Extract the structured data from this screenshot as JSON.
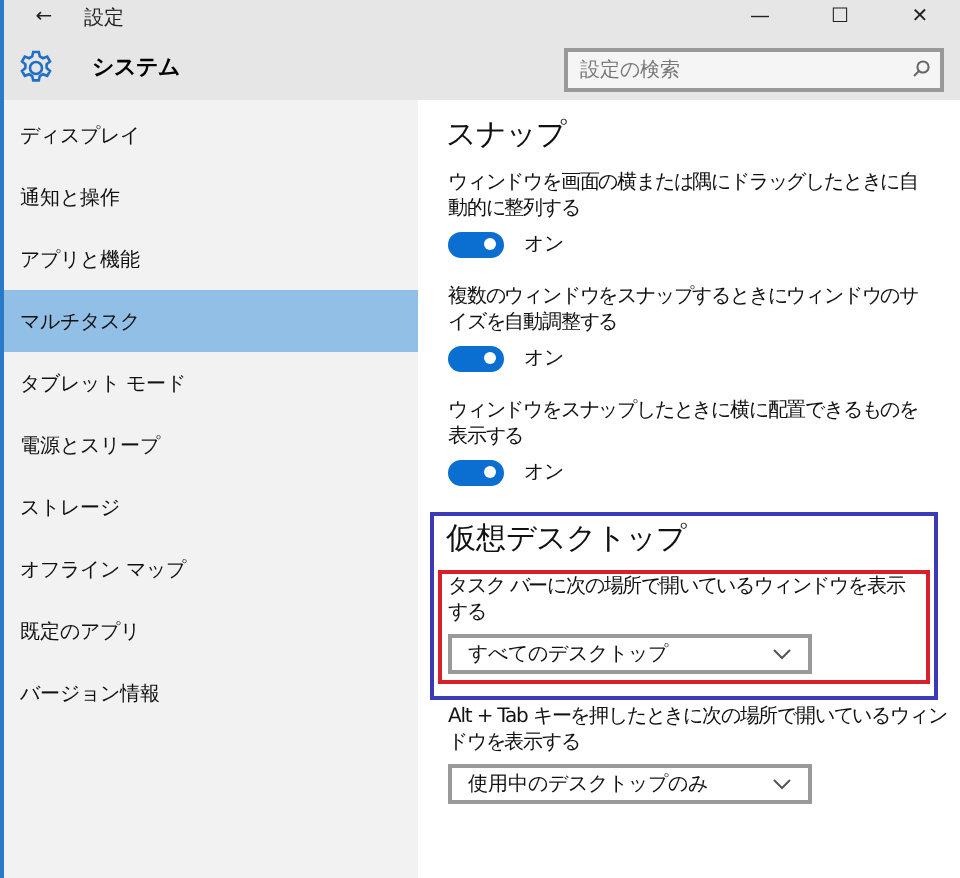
{
  "window": {
    "back": "←",
    "title": "設定",
    "controls": [
      "—",
      "☐",
      "✕"
    ]
  },
  "header": {
    "title": "システム",
    "search": {
      "placeholder": "設定の検索"
    }
  },
  "sidebar": {
    "items": [
      {
        "label": "ディスプレイ",
        "selected": false
      },
      {
        "label": "通知と操作",
        "selected": false
      },
      {
        "label": "アプリと機能",
        "selected": false
      },
      {
        "label": "マルチタスク",
        "selected": true
      },
      {
        "label": "タブレット モード",
        "selected": false
      },
      {
        "label": "電源とスリープ",
        "selected": false
      },
      {
        "label": "ストレージ",
        "selected": false
      },
      {
        "label": "オフライン マップ",
        "selected": false
      },
      {
        "label": "既定のアプリ",
        "selected": false
      },
      {
        "label": "バージョン情報",
        "selected": false
      }
    ]
  },
  "sections": [
    {
      "title": "スナップ",
      "outlined": false,
      "settings": [
        {
          "kind": "toggle",
          "label": "ウィンドウを画面の横または隅にドラッグしたときに自動的に整列する",
          "on": true,
          "state_text": "オン",
          "outlined": false
        },
        {
          "kind": "toggle",
          "label": "複数のウィンドウをスナップするときにウィンドウのサイズを自動調整する",
          "on": true,
          "state_text": "オン",
          "outlined": false
        },
        {
          "kind": "toggle",
          "label": "ウィンドウをスナップしたときに横に配置できるものを表示する",
          "on": true,
          "state_text": "オン",
          "outlined": false
        }
      ]
    },
    {
      "title": "仮想デスクトップ",
      "outlined": true,
      "settings": [
        {
          "kind": "dropdown",
          "label": "タスク バーに次の場所で開いているウィンドウを表示する",
          "value": "すべてのデスクトップ",
          "outlined": true
        }
      ]
    },
    {
      "settings": [
        {
          "kind": "dropdown",
          "label": "Alt + Tab キーを押したときに次の場所で開いているウィンドウを表示する",
          "value": "使用中のデスクトップのみ",
          "outlined": false
        }
      ]
    }
  ]
}
